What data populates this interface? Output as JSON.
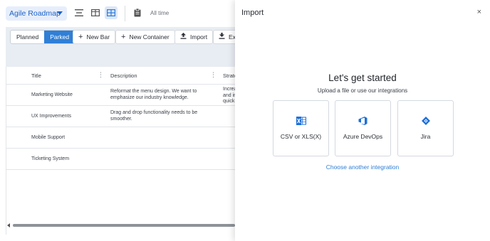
{
  "topbar": {
    "roadmap_name": "Agile Roadmap",
    "time_filter": "All time"
  },
  "toolbar": {
    "segment": [
      "Planned",
      "Parked"
    ],
    "segment_selected": "Parked",
    "new_bar": "New Bar",
    "new_container": "New Container",
    "import": "Import",
    "export": "Exp"
  },
  "table": {
    "columns": [
      "Title",
      "Description",
      "Strate"
    ],
    "rows": [
      {
        "title": "Marketing Website",
        "description": "Reformat the menu design. We want to emphasize our industry knowledge.",
        "strategy": [
          "Increa",
          "and in",
          "quick"
        ]
      },
      {
        "title": "UX Improvements",
        "description": "Drag and drop functionality needs to be smoother.",
        "strategy": []
      },
      {
        "title": "Mobile Support",
        "description": "",
        "strategy": []
      },
      {
        "title": "Ticketing System",
        "description": "",
        "strategy": []
      }
    ]
  },
  "import_panel": {
    "title": "Import",
    "close_glyph": "×",
    "heading": "Let's get started",
    "subheading": "Upload a file or use our integrations",
    "options": [
      {
        "label": "CSV or XLS(X)",
        "icon": "excel-icon",
        "color": "#1d6fd8"
      },
      {
        "label": "Azure DevOps",
        "icon": "azure-devops-icon",
        "color": "#1d6fd8"
      },
      {
        "label": "Jira",
        "icon": "jira-icon",
        "color": "#1d6fd8"
      }
    ],
    "other_link": "Choose another integration"
  },
  "colors": {
    "accent": "#2f7fd6",
    "toolbar_bg": "#e8edf3",
    "link": "#2f7fd6"
  }
}
